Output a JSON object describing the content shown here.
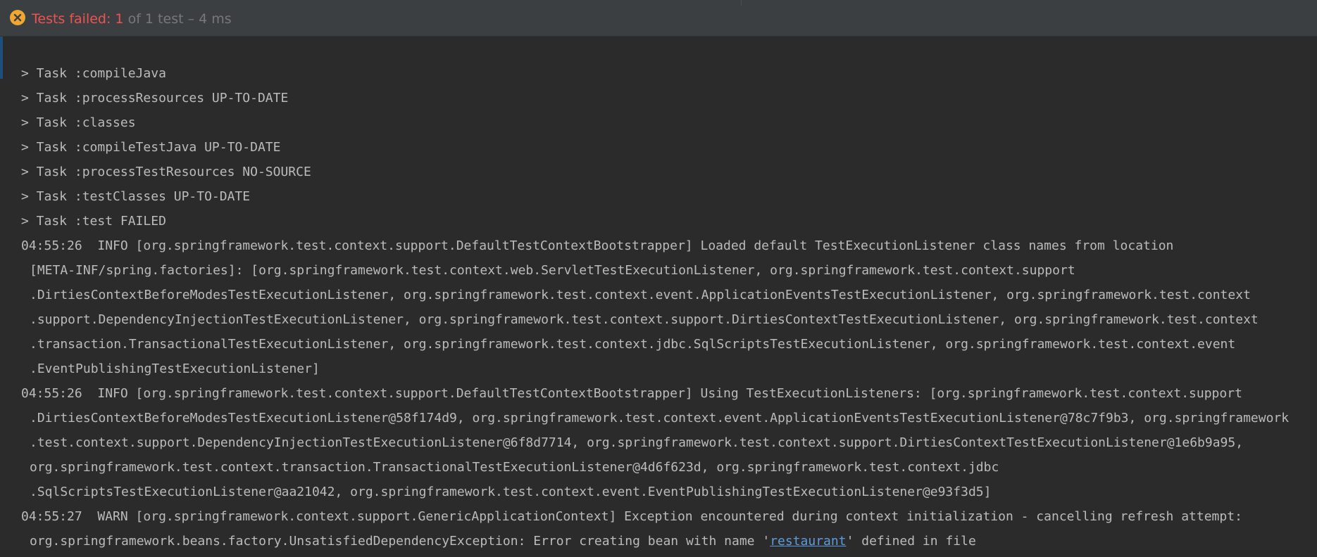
{
  "status": {
    "failed_text": "Tests failed: 1",
    "rest_text": " of 1 test – 4 ms",
    "icon": "error-circle-icon",
    "colors": {
      "failed": "#ef5350",
      "icon": "#f0a732"
    }
  },
  "console": {
    "lines": [
      "> Task :compileJava",
      "> Task :processResources UP-TO-DATE",
      "> Task :classes",
      "> Task :compileTestJava UP-TO-DATE",
      "> Task :processTestResources NO-SOURCE",
      "> Task :testClasses UP-TO-DATE",
      "> Task :test FAILED",
      "04:55:26  INFO [org.springframework.test.context.support.DefaultTestContextBootstrapper] Loaded default TestExecutionListener class names from location",
      "[META-INF/spring.factories]: [org.springframework.test.context.web.ServletTestExecutionListener, org.springframework.test.context.support",
      ".DirtiesContextBeforeModesTestExecutionListener, org.springframework.test.context.event.ApplicationEventsTestExecutionListener, org.springframework.test.context",
      ".support.DependencyInjectionTestExecutionListener, org.springframework.test.context.support.DirtiesContextTestExecutionListener, org.springframework.test.context",
      ".transaction.TransactionalTestExecutionListener, org.springframework.test.context.jdbc.SqlScriptsTestExecutionListener, org.springframework.test.context.event",
      ".EventPublishingTestExecutionListener]",
      "04:55:26  INFO [org.springframework.test.context.support.DefaultTestContextBootstrapper] Using TestExecutionListeners: [org.springframework.test.context.support",
      ".DirtiesContextBeforeModesTestExecutionListener@58f174d9, org.springframework.test.context.event.ApplicationEventsTestExecutionListener@78c7f9b3, org.springframework",
      ".test.context.support.DependencyInjectionTestExecutionListener@6f8d7714, org.springframework.test.context.support.DirtiesContextTestExecutionListener@1e6b9a95,",
      "org.springframework.test.context.transaction.TransactionalTestExecutionListener@4d6f623d, org.springframework.test.context.jdbc",
      ".SqlScriptsTestExecutionListener@aa21042, org.springframework.test.context.event.EventPublishingTestExecutionListener@e93f3d5]",
      "04:55:27  WARN [org.springframework.context.support.GenericApplicationContext] Exception encountered during context initialization - cancelling refresh attempt:"
    ],
    "last_line": {
      "prefix": "org.springframework.beans.factory.UnsatisfiedDependencyException: Error creating bean with name '",
      "link": "restaurant",
      "suffix": "' defined in file"
    }
  }
}
